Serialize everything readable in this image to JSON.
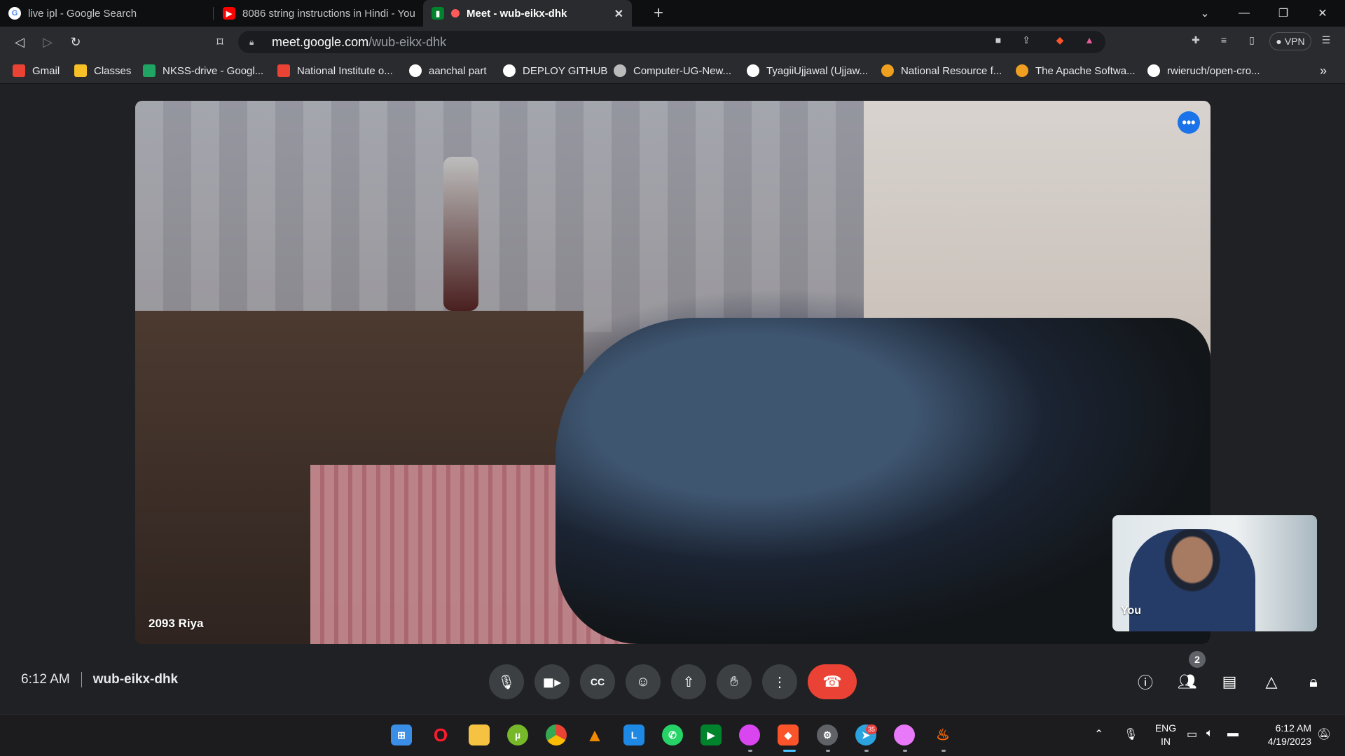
{
  "browser": {
    "tabs": [
      {
        "title": "live ipl - Google Search",
        "icon": "google-icon"
      },
      {
        "title": "8086 string instructions in Hindi - You",
        "icon": "youtube-icon"
      },
      {
        "title": "Meet - wub-eikx-dhk",
        "icon": "meet-icon",
        "active": true
      }
    ],
    "new_tab": "+",
    "address": {
      "domain": "meet.google.com",
      "path": "/wub-eikx-dhk"
    },
    "vpn_label": "VPN",
    "bookmarks": [
      {
        "label": "Gmail",
        "icon": "gmail-icon"
      },
      {
        "label": "Classes",
        "icon": "classroom-icon"
      },
      {
        "label": "NKSS-drive - Googl...",
        "icon": "drive-icon"
      },
      {
        "label": "National Institute o...",
        "icon": "gmail-icon"
      },
      {
        "label": "aanchal part",
        "icon": "github-icon"
      },
      {
        "label": "DEPLOY GITHUB",
        "icon": "github-icon"
      },
      {
        "label": "Computer-UG-New...",
        "icon": "globe-icon"
      },
      {
        "label": "TyagiiUjjawal (Ujjaw...",
        "icon": "github-icon"
      },
      {
        "label": "National Resource f...",
        "icon": "code-icon"
      },
      {
        "label": "The Apache Softwa...",
        "icon": "code-icon"
      },
      {
        "label": "rwieruch/open-cro...",
        "icon": "github-icon"
      }
    ],
    "bookmarks_overflow": "»"
  },
  "meet": {
    "main_participant": "2093 Riya",
    "self_label": "You",
    "time": "6:12 AM",
    "meeting_code": "wub-eikx-dhk",
    "participant_count": "2"
  },
  "taskbar": {
    "lang_top": "ENG",
    "lang_bottom": "IN",
    "clock_time": "6:12 AM",
    "clock_date": "4/19/2023",
    "telegram_badge": "35"
  },
  "colors": {
    "hangup": "#ea4335",
    "accent": "#1a73e8",
    "control_bg": "#3c4043"
  }
}
